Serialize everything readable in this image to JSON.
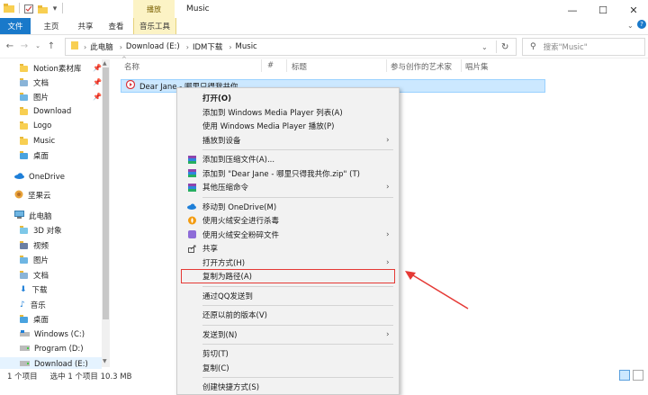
{
  "titlebar": {
    "context_tab": "播放",
    "window_title": "Music",
    "controls": [
      "—",
      "☐",
      "✕"
    ]
  },
  "ribbon": {
    "tabs": [
      {
        "label": "文件"
      },
      {
        "label": "主页"
      },
      {
        "label": "共享"
      },
      {
        "label": "查看"
      },
      {
        "label": "音乐工具"
      }
    ]
  },
  "address": {
    "crumbs": [
      "此电脑",
      "Download (E:)",
      "IDM下载",
      "Music"
    ],
    "search_placeholder": "搜索\"Music\""
  },
  "sidebar": {
    "items": [
      {
        "label": "Notion素材库",
        "pinned": true
      },
      {
        "label": "文档",
        "pinned": true
      },
      {
        "label": "图片",
        "pinned": true
      },
      {
        "label": "Download"
      },
      {
        "label": "Logo"
      },
      {
        "label": "Music"
      },
      {
        "label": "桌面"
      },
      {
        "label": "OneDrive"
      },
      {
        "label": "坚果云"
      },
      {
        "label": "此电脑"
      },
      {
        "label": "3D 对象"
      },
      {
        "label": "视频"
      },
      {
        "label": "图片"
      },
      {
        "label": "文档"
      },
      {
        "label": "下载"
      },
      {
        "label": "音乐"
      },
      {
        "label": "桌面"
      },
      {
        "label": "Windows (C:)"
      },
      {
        "label": "Program (D:)"
      },
      {
        "label": "Download (E:)"
      }
    ]
  },
  "columns": [
    "名称",
    "#",
    "标题",
    "参与创作的艺术家",
    "唱片集"
  ],
  "file": {
    "name": "Dear Jane - 哪里只得我共你"
  },
  "context_menu": {
    "items": [
      {
        "label": "打开(O)",
        "bold": true
      },
      {
        "label": "添加到 Windows Media Player 列表(A)"
      },
      {
        "label": "使用 Windows Media Player 播放(P)"
      },
      {
        "label": "播放到设备",
        "arrow": true
      },
      {
        "sep": true
      },
      {
        "label": "添加到压缩文件(A)...",
        "icon": "archive-icon"
      },
      {
        "label": "添加到 \"Dear Jane - 哪里只得我共你.zip\" (T)",
        "icon": "archive-icon"
      },
      {
        "label": "其他压缩命令",
        "icon": "archive-icon",
        "arrow": true
      },
      {
        "sep": true
      },
      {
        "label": "移动到 OneDrive(M)",
        "icon": "cloud-icon"
      },
      {
        "label": "使用火绒安全进行杀毒",
        "icon": "fire-icon"
      },
      {
        "label": "使用火绒安全粉碎文件",
        "icon": "shredder-icon",
        "arrow": true
      },
      {
        "label": "共享",
        "icon": "share-icon"
      },
      {
        "label": "打开方式(H)",
        "arrow": true
      },
      {
        "label": "复制为路径(A)",
        "highlighted": true
      },
      {
        "sep": true
      },
      {
        "label": "通过QQ发送到"
      },
      {
        "sep": true
      },
      {
        "label": "还原以前的版本(V)"
      },
      {
        "sep": true
      },
      {
        "label": "发送到(N)",
        "arrow": true
      },
      {
        "sep": true
      },
      {
        "label": "剪切(T)"
      },
      {
        "label": "复制(C)"
      },
      {
        "sep": true
      },
      {
        "label": "创建快捷方式(S)"
      }
    ]
  },
  "statusbar": {
    "count": "1 个项目",
    "selected": "选中 1 个项目  10.3 MB"
  },
  "annotation_color": "#e53935"
}
